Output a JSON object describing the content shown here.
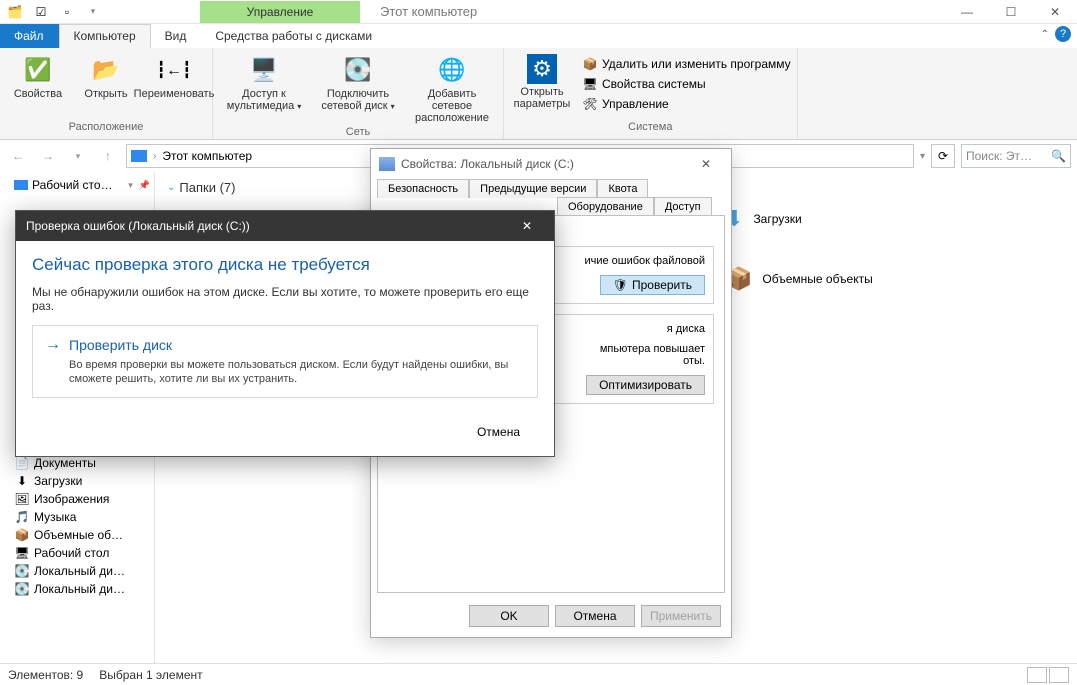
{
  "titlebar": {
    "manage": "Управление",
    "window_title": "Этот компьютер"
  },
  "tabs": {
    "file": "Файл",
    "computer": "Компьютер",
    "view": "Вид",
    "disk_tools": "Средства работы с дисками"
  },
  "ribbon": {
    "location": {
      "label": "Расположение",
      "properties": "Свойства",
      "open": "Открыть",
      "rename": "Переименовать"
    },
    "network": {
      "label": "Сеть",
      "media": "Доступ к мультимедиа",
      "mapdrive": "Подключить сетевой диск",
      "addloc": "Добавить сетевое расположение"
    },
    "system": {
      "label": "Система",
      "open_params": "Открыть параметры",
      "links": {
        "uninstall": "Удалить или изменить программу",
        "sysprops": "Свойства системы",
        "manage": "Управление"
      }
    }
  },
  "address": {
    "path": "Этот компьютер"
  },
  "search": {
    "placeholder": "Поиск: Эт…"
  },
  "tree": {
    "top": "Рабочий сто…",
    "items": [
      "Документы",
      "Загрузки",
      "Изображения",
      "Музыка",
      "Объемные об…",
      "Рабочий стол",
      "Локальный ди…",
      "Локальный ди…"
    ]
  },
  "tree_icons": [
    "📄",
    "⬇",
    "🖼",
    "🎵",
    "📦",
    "🖥",
    "💽",
    "💽"
  ],
  "content": {
    "folders_header": "Папки (7)",
    "right_items": [
      "Загрузки",
      "Объемные объекты"
    ]
  },
  "status": {
    "count": "Элементов: 9",
    "selected": "Выбран 1 элемент"
  },
  "props": {
    "title": "Свойства: Локальный диск (C:)",
    "tabs_row1": [
      "Безопасность",
      "Предыдущие версии",
      "Квота"
    ],
    "tabs_row2": [
      "Оборудование",
      "Доступ"
    ],
    "box1": {
      "partial_text": "ичие ошибок файловой",
      "btn": "Проверить"
    },
    "box2": {
      "l1": "я диска",
      "l2": "мпьютера повышает",
      "l3": "оты.",
      "btn": "Оптимизировать"
    },
    "footer": {
      "ok": "OK",
      "cancel": "Отмена",
      "apply": "Применить"
    }
  },
  "modal": {
    "title": "Проверка ошибок (Локальный диск (C:))",
    "heading": "Сейчас проверка этого диска не требуется",
    "body": "Мы не обнаружили ошибок на этом диске. Если вы хотите, то можете проверить его еще раз.",
    "action_title": "Проверить диск",
    "action_desc": "Во время проверки вы можете пользоваться диском. Если будут найдены ошибки, вы сможете решить, хотите ли вы их устранить.",
    "cancel": "Отмена"
  }
}
